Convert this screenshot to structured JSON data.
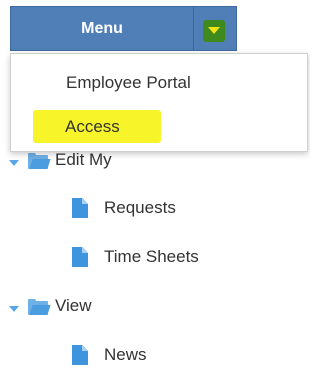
{
  "menu": {
    "title": "Menu",
    "toggle_icon": "chevron-down-icon",
    "colors": {
      "bar": "#4f7fb6",
      "toggle": "#3f8a1c",
      "chevron": "#f3e418",
      "highlight": "#f7f52a"
    },
    "items": [
      {
        "label": "Employee Portal"
      },
      {
        "label": "Access",
        "highlighted": true
      }
    ]
  },
  "tree": {
    "groups": [
      {
        "label": "Edit My",
        "expanded": true,
        "icon": "folder-open-icon",
        "children": [
          {
            "label": "Requests",
            "icon": "document-icon"
          },
          {
            "label": "Time Sheets",
            "icon": "document-icon"
          }
        ]
      },
      {
        "label": "View",
        "expanded": true,
        "icon": "folder-open-icon",
        "children": [
          {
            "label": "News",
            "icon": "document-icon"
          }
        ]
      }
    ],
    "colors": {
      "caret": "#58a6e8",
      "folder": "#4c9ce0",
      "document": "#3f95dd"
    }
  }
}
